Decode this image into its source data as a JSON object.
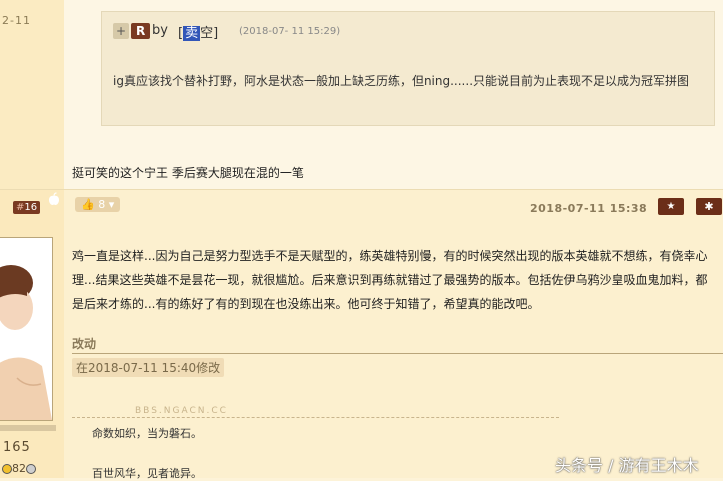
{
  "top_post": {
    "date_fragment": "2-11",
    "quote": {
      "plus": "+",
      "r_badge": "R",
      "by": "by",
      "author_bracket_open": "[",
      "author_mark": "卖",
      "author_rest": "空",
      "author_bracket_close": "]",
      "date": "(2018-07- 11 15:29)",
      "text": "ig真应该找个替补打野，阿水是状态一般加上缺乏历练，但ning......只能说目前为止表现不足以成为冠军拼图"
    },
    "reply_text": "挺可笑的这个宁王 季后赛大腿现在混的一笔"
  },
  "post16": {
    "floor": "16",
    "vote_count": "8",
    "date": "2018-07-11 15:38",
    "star_label": "★",
    "gear_label": "✱",
    "author_number": "165",
    "coin_text": "82",
    "text": "鸡一直是这样...因为自己是努力型选手不是天赋型的，练英雄特别慢，有的时候突然出现的版本英雄就不想练，有侥幸心理...结果这些英雄不是昙花一现，就很尴尬。后来意识到再练就错过了最强势的版本。包括佐伊乌鸦沙皇吸血鬼加料，都是后来才练的...有的练好了有的到现在也没练出来。他可终于知错了，希望真的能改吧。",
    "edit_title": "改动",
    "edit_badge": "在2018-07-11 15:40修改",
    "signature": {
      "watermark": "BBS.NGACN.CC",
      "line1": "命数如织，当为磐石。",
      "line2": "百世风华，见者诡异。"
    }
  },
  "site_watermark": "头条号 / 游有王木木",
  "colors": {
    "badge_dark": "#7a3a22",
    "button_dark": "#6b2e18",
    "page_bg": "#fdf3d8",
    "author_mark_bg": "#3256b8"
  }
}
